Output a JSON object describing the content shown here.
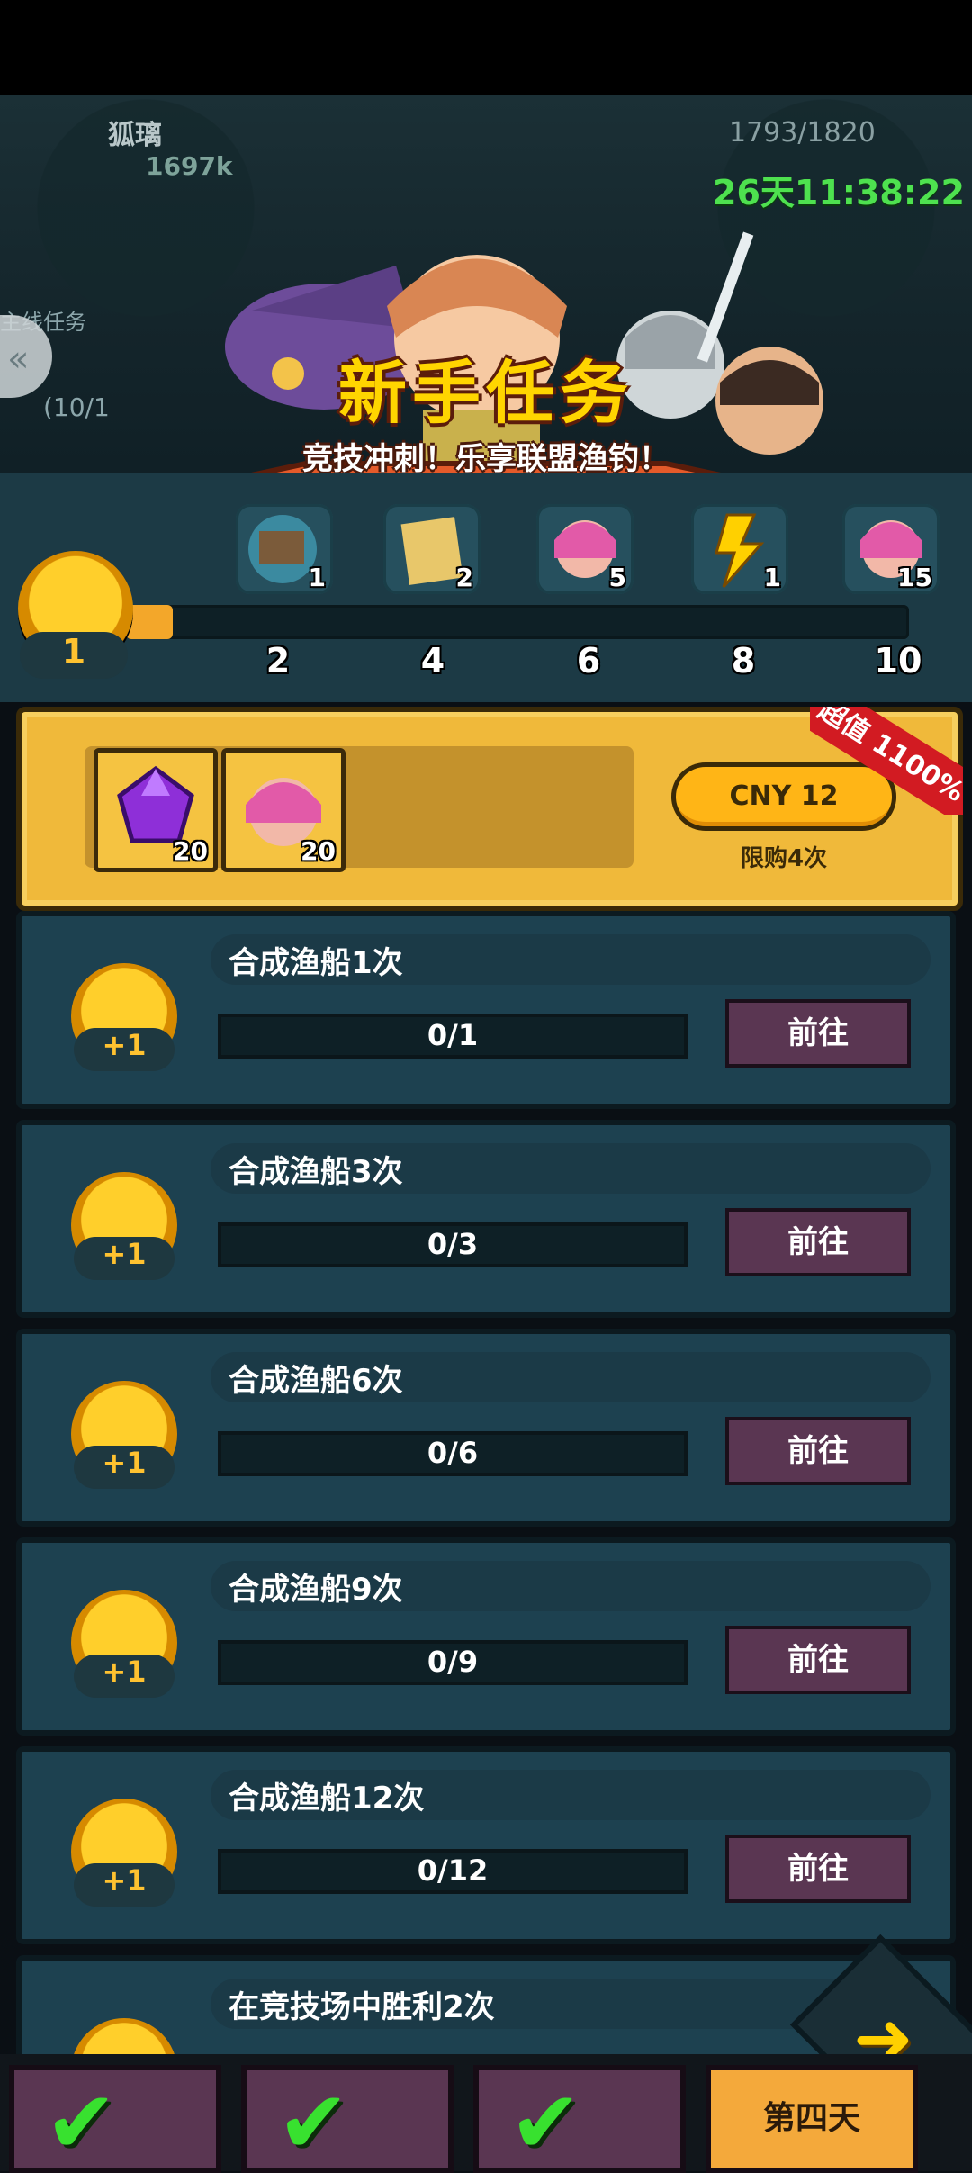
{
  "status_bar": {},
  "header": {
    "player_name": "狐璃",
    "power": "1697k",
    "energy": "1793/1820",
    "timer": "26天11:38:22",
    "side_tab_label": "主线任务",
    "side_counter": "(10/1"
  },
  "banner": {
    "title": "新手任务",
    "subtitle": "竞技冲刺！乐享联盟渔钓！"
  },
  "milestones": {
    "current_points": "1",
    "progress_fraction": 0.06,
    "labels": [
      "2",
      "4",
      "6",
      "8",
      "10"
    ],
    "rewards": [
      {
        "icon": "robot-mech-icon",
        "count": "1"
      },
      {
        "icon": "scroll-map-icon",
        "count": "2"
      },
      {
        "icon": "pink-hair-hero-icon",
        "count": "5"
      },
      {
        "icon": "lightning-icon",
        "count": "1"
      },
      {
        "icon": "pink-hair-hero-icon",
        "count": "15"
      }
    ]
  },
  "offer": {
    "items": [
      {
        "icon": "purple-gem-icon",
        "count": "20"
      },
      {
        "icon": "pink-hair-hero-icon",
        "count": "20"
      }
    ],
    "price": "CNY 12",
    "limit": "限购4次",
    "badge_line1": "超值",
    "badge_line2": "1100%"
  },
  "tasks": [
    {
      "title": "合成渔船1次",
      "progress": "0/1",
      "reward": "+1",
      "button": "前往"
    },
    {
      "title": "合成渔船3次",
      "progress": "0/3",
      "reward": "+1",
      "button": "前往"
    },
    {
      "title": "合成渔船6次",
      "progress": "0/6",
      "reward": "+1",
      "button": "前往"
    },
    {
      "title": "合成渔船9次",
      "progress": "0/9",
      "reward": "+1",
      "button": "前往"
    },
    {
      "title": "合成渔船12次",
      "progress": "0/12",
      "reward": "+1",
      "button": "前往"
    },
    {
      "title": "在竞技场中胜利2次"
    }
  ],
  "bottom_tabs": {
    "active_label": "第四天"
  },
  "colors": {
    "timer": "#4ee14f",
    "accent_gold": "#f0b93a",
    "task_bg": "#1d4150",
    "goto_button": "#5a3652"
  }
}
